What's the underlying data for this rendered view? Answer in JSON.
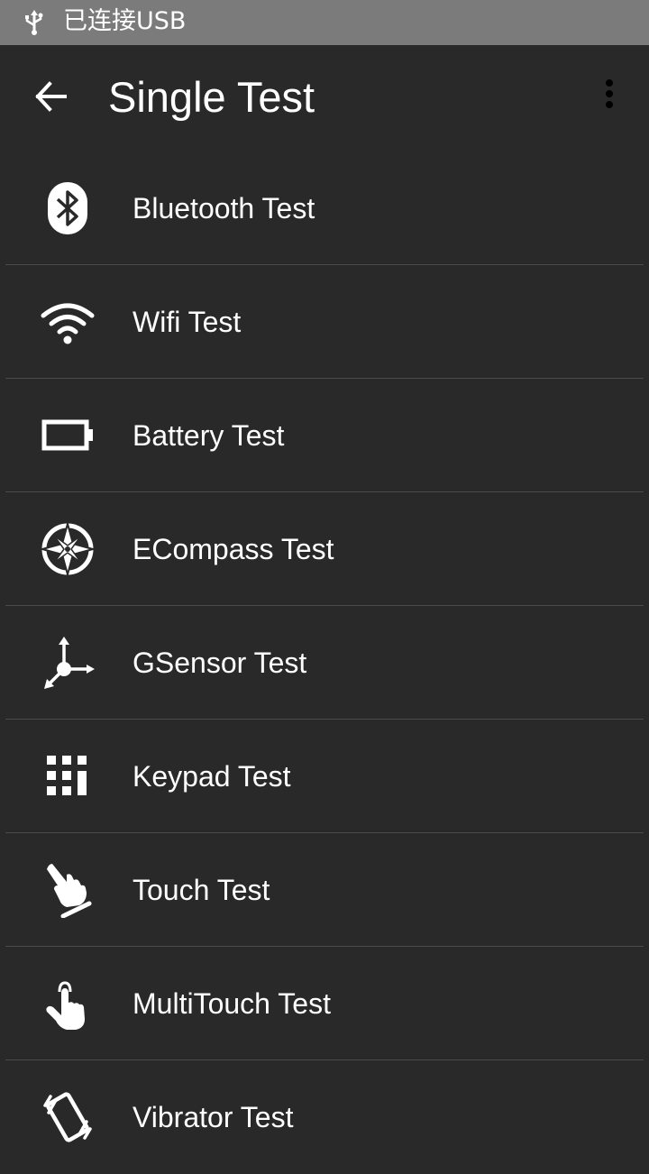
{
  "status_bar": {
    "usb_icon": "usb-icon",
    "text": "已连接USB"
  },
  "app_bar": {
    "back_icon": "arrow-back-icon",
    "title": "Single Test",
    "menu_icon": "more-vert-icon"
  },
  "colors": {
    "background": "#292929",
    "status_bar": "#7b7b7b",
    "divider": "#4a4a4a",
    "text": "#ffffff"
  },
  "items": [
    {
      "label": "Bluetooth Test",
      "icon": "bluetooth-icon"
    },
    {
      "label": "Wifi Test",
      "icon": "wifi-icon"
    },
    {
      "label": "Battery Test",
      "icon": "battery-icon"
    },
    {
      "label": "ECompass Test",
      "icon": "compass-icon"
    },
    {
      "label": "GSensor Test",
      "icon": "axes-icon"
    },
    {
      "label": "Keypad Test",
      "icon": "keypad-icon"
    },
    {
      "label": "Touch Test",
      "icon": "touch-icon"
    },
    {
      "label": "MultiTouch Test",
      "icon": "multitouch-icon"
    },
    {
      "label": "Vibrator Test",
      "icon": "vibrate-icon"
    }
  ]
}
